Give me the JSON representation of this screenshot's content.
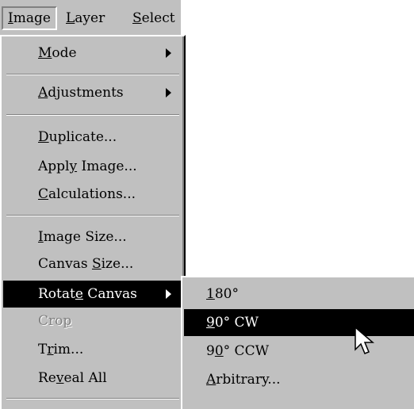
{
  "menubar": {
    "items": [
      {
        "first": "I",
        "rest": "mage"
      },
      {
        "first": "L",
        "rest": "ayer"
      },
      {
        "first": "S",
        "rest": "elect"
      }
    ]
  },
  "image_menu": {
    "mode": {
      "u": "M",
      "rest": "ode"
    },
    "adjustments": {
      "u": "A",
      "rest": "djustments"
    },
    "duplicate": {
      "u": "D",
      "rest": "uplicate..."
    },
    "apply_image": {
      "before": "Appl",
      "u": "y",
      "after": " Image..."
    },
    "calculations": {
      "u": "C",
      "rest": "alculations..."
    },
    "image_size": {
      "u": "I",
      "rest": "mage Size..."
    },
    "canvas_size": {
      "before": "Canvas ",
      "u": "S",
      "after": "ize..."
    },
    "rotate_canvas": {
      "before": "Rotat",
      "u": "e",
      "after": " Canvas"
    },
    "crop": {
      "before": "Cro",
      "u": "p",
      "after": ""
    },
    "trim": {
      "before": "T",
      "u": "r",
      "after": "im..."
    },
    "reveal_all": {
      "before": "Re",
      "u": "v",
      "after": "eal All"
    }
  },
  "rotate_submenu": {
    "r180": {
      "u": "1",
      "rest": "80°"
    },
    "r90cw": {
      "u": "9",
      "rest": "0° CW"
    },
    "r90ccw": {
      "before": "9",
      "u": "0",
      "after": "° CCW"
    },
    "arbitrary": {
      "u": "A",
      "rest": "rbitrary..."
    }
  },
  "icons": {
    "cursor": "arrow-pointer-icon",
    "submenu_arrow": "triangle-right-icon"
  },
  "colors": {
    "menu_bg": "#c0c0c0",
    "highlight_bg": "#000000",
    "highlight_fg": "#ffffff",
    "disabled_fg": "#808080"
  }
}
